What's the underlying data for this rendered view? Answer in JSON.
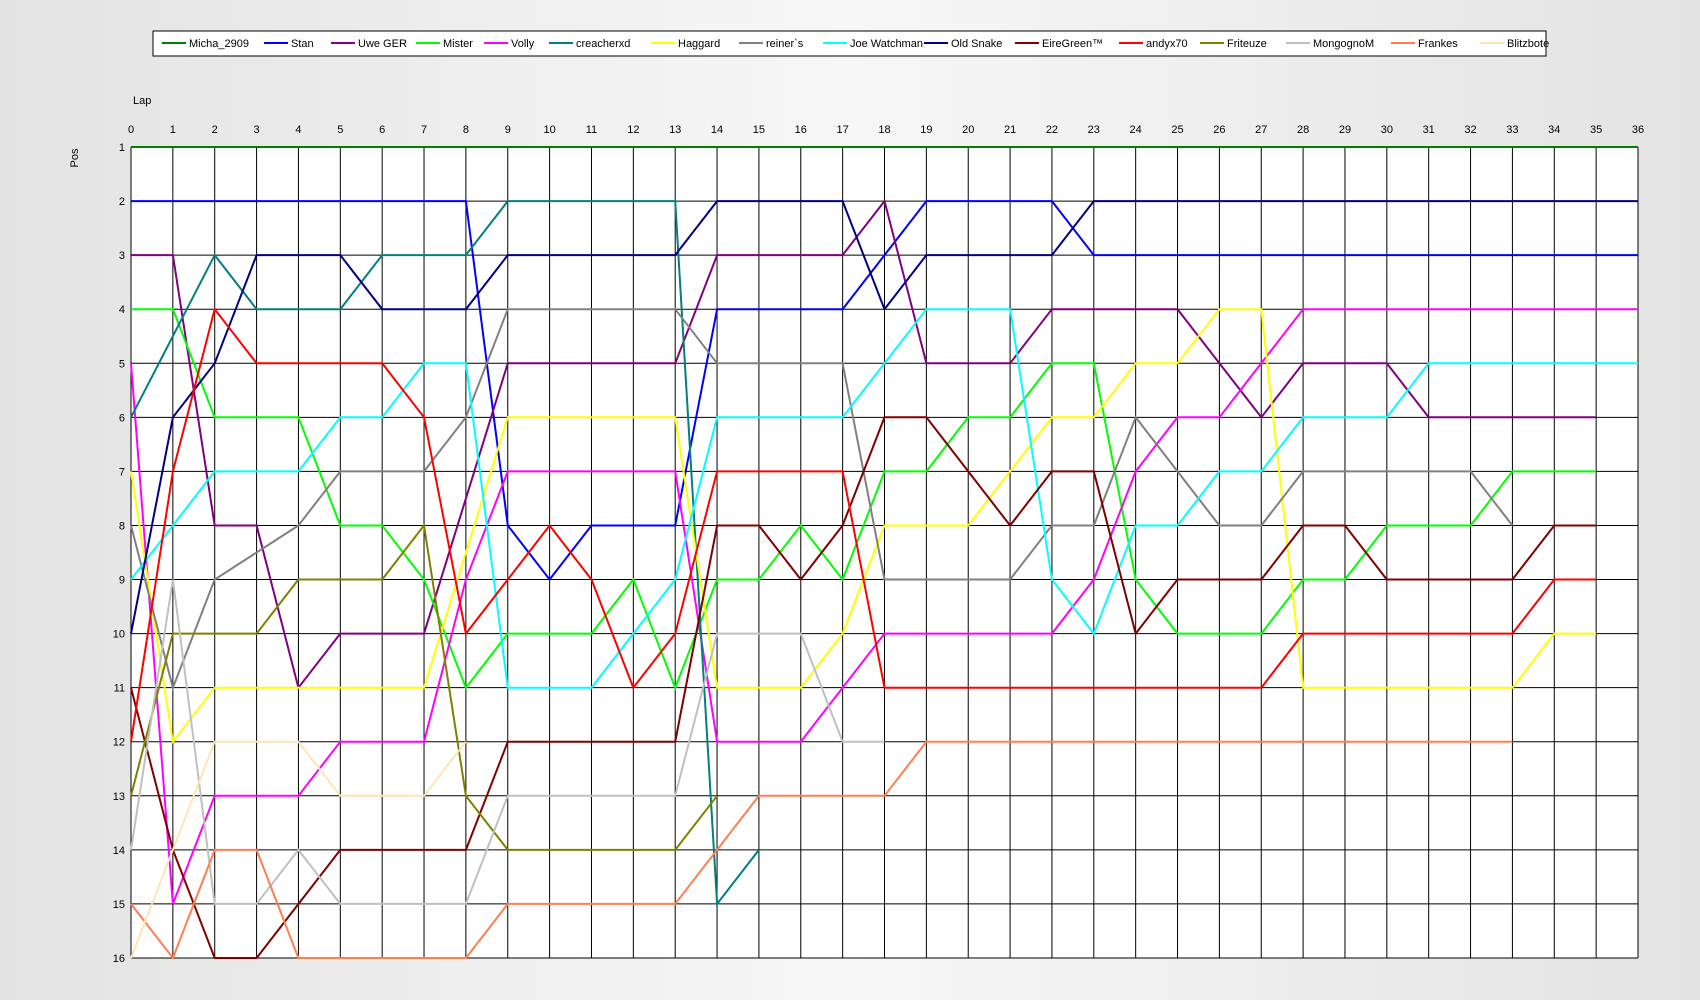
{
  "chart_data": {
    "type": "line",
    "xlabel": "Lap",
    "ylabel": "Pos",
    "xlim": [
      0,
      36
    ],
    "ylim": [
      1,
      16
    ],
    "y_inverted": true,
    "grid": true,
    "legend_position": "top",
    "x_ticks": [
      "0",
      "1",
      "2",
      "3",
      "4",
      "5",
      "6",
      "7",
      "8",
      "9",
      "10",
      "11",
      "12",
      "13",
      "14",
      "15",
      "16",
      "17",
      "18",
      "19",
      "20",
      "21",
      "22",
      "23",
      "24",
      "25",
      "26",
      "27",
      "28",
      "29",
      "30",
      "31",
      "32",
      "33",
      "34",
      "35",
      "36"
    ],
    "y_ticks": [
      "1",
      "2",
      "3",
      "4",
      "5",
      "6",
      "7",
      "8",
      "9",
      "10",
      "11",
      "12",
      "13",
      "14",
      "15",
      "16"
    ],
    "series": [
      {
        "name": "Micha_2909",
        "color": "#008000",
        "x": [
          0,
          36
        ],
        "y": [
          1,
          1
        ]
      },
      {
        "name": "Stan",
        "color": "#0000ff",
        "x": [
          0,
          8,
          9,
          10,
          11,
          13,
          14,
          17,
          19,
          22,
          23,
          36
        ],
        "y": [
          2,
          2,
          8,
          9,
          8,
          8,
          4,
          4,
          2,
          2,
          3,
          3
        ]
      },
      {
        "name": "Uwe GER",
        "color": "#800080",
        "x": [
          0,
          1,
          2,
          3,
          4,
          5,
          7,
          9,
          13,
          14,
          17,
          18,
          19,
          21,
          22,
          25,
          27,
          28,
          30,
          31,
          35
        ],
        "y": [
          3,
          3,
          8,
          8,
          11,
          10,
          10,
          5,
          5,
          3,
          3,
          2,
          5,
          5,
          4,
          4,
          6,
          5,
          5,
          6,
          6
        ]
      },
      {
        "name": "Mister",
        "color": "#00ff00",
        "x": [
          0,
          1,
          2,
          4,
          5,
          6,
          7,
          8,
          9,
          11,
          12,
          13,
          14,
          15,
          16,
          17,
          18,
          19,
          20,
          21,
          22,
          23,
          24,
          25,
          27,
          28,
          29,
          30,
          32,
          33,
          35
        ],
        "y": [
          4,
          4,
          6,
          6,
          8,
          8,
          9,
          11,
          10,
          10,
          9,
          11,
          9,
          9,
          8,
          9,
          7,
          7,
          6,
          6,
          5,
          5,
          9,
          10,
          10,
          9,
          9,
          8,
          8,
          7,
          7
        ]
      },
      {
        "name": "Volly",
        "color": "#ff00ff",
        "x": [
          0,
          1,
          2,
          4,
          5,
          7,
          8,
          9,
          13,
          14,
          16,
          18,
          22,
          23,
          24,
          25,
          26,
          28,
          36
        ],
        "y": [
          5,
          15,
          13,
          13,
          12,
          12,
          9,
          7,
          7,
          12,
          12,
          10,
          10,
          9,
          7,
          6,
          6,
          4,
          4
        ]
      },
      {
        "name": "creacherxd",
        "color": "#008080",
        "x": [
          0,
          2,
          3,
          5,
          6,
          8,
          9,
          13,
          14,
          15
        ],
        "y": [
          6,
          3,
          4,
          4,
          3,
          3,
          2,
          2,
          15,
          14
        ]
      },
      {
        "name": "Haggard",
        "color": "#ffff00",
        "x": [
          0,
          1,
          2,
          3,
          5,
          7,
          9,
          13,
          14,
          16,
          17,
          18,
          20,
          22,
          23,
          24,
          25,
          26,
          27,
          28,
          33,
          34,
          35
        ],
        "y": [
          7,
          12,
          11,
          11,
          11,
          11,
          6,
          6,
          11,
          11,
          10,
          8,
          8,
          6,
          6,
          5,
          5,
          4,
          4,
          11,
          11,
          10,
          10
        ]
      },
      {
        "name": "reiner`s",
        "color": "#808080",
        "x": [
          0,
          1,
          2,
          4,
          5,
          6,
          7,
          8,
          9,
          13,
          14,
          16,
          17,
          18,
          21,
          22,
          23,
          24,
          25,
          26,
          27,
          28,
          32,
          33
        ],
        "y": [
          8,
          11,
          9,
          8,
          7,
          7,
          7,
          6,
          4,
          4,
          5,
          5,
          5,
          9,
          9,
          8,
          8,
          6,
          7,
          8,
          8,
          7,
          7,
          8
        ]
      },
      {
        "name": "Joe Watchman",
        "color": "#00ffff",
        "x": [
          0,
          1,
          2,
          4,
          5,
          6,
          7,
          8,
          9,
          11,
          12,
          13,
          14,
          15,
          17,
          18,
          19,
          21,
          22,
          23,
          24,
          25,
          26,
          27,
          28,
          30,
          31,
          36
        ],
        "y": [
          9,
          8,
          7,
          7,
          6,
          6,
          5,
          5,
          11,
          11,
          10,
          9,
          6,
          6,
          6,
          5,
          4,
          4,
          9,
          10,
          8,
          8,
          7,
          7,
          6,
          6,
          5,
          5
        ]
      },
      {
        "name": "Old Snake",
        "color": "#000080",
        "x": [
          0,
          1,
          2,
          3,
          5,
          6,
          8,
          9,
          13,
          14,
          17,
          18,
          19,
          22,
          23,
          36
        ],
        "y": [
          10,
          6,
          5,
          3,
          3,
          4,
          4,
          3,
          3,
          2,
          2,
          4,
          3,
          3,
          2,
          2
        ]
      },
      {
        "name": "EireGreen™",
        "color": "#800000",
        "x": [
          0,
          1,
          2,
          3,
          5,
          8,
          9,
          13,
          14,
          15,
          16,
          17,
          18,
          19,
          21,
          22,
          23,
          24,
          25,
          27,
          28,
          29,
          30,
          33,
          34,
          35
        ],
        "y": [
          11,
          14,
          16,
          16,
          14,
          14,
          12,
          12,
          8,
          8,
          9,
          8,
          6,
          6,
          8,
          7,
          7,
          10,
          9,
          9,
          8,
          8,
          9,
          9,
          8,
          8
        ]
      },
      {
        "name": "andyx70",
        "color": "#ff0000",
        "x": [
          0,
          1,
          2,
          3,
          6,
          7,
          8,
          10,
          11,
          12,
          13,
          14,
          17,
          18,
          27,
          28,
          33,
          34,
          35
        ],
        "y": [
          12,
          7,
          4,
          5,
          5,
          6,
          10,
          8,
          9,
          11,
          10,
          7,
          7,
          11,
          11,
          10,
          10,
          9,
          9
        ]
      },
      {
        "name": "Friteuze",
        "color": "#808000",
        "x": [
          0,
          1,
          3,
          4,
          6,
          7,
          8,
          9,
          13,
          14
        ],
        "y": [
          13,
          10,
          10,
          9,
          9,
          8,
          13,
          14,
          14,
          13
        ]
      },
      {
        "name": "MongognoM",
        "color": "#c0c0c0",
        "x": [
          0,
          1,
          2,
          3,
          4,
          5,
          8,
          9,
          13,
          14,
          16,
          17,
          18
        ],
        "y": [
          14,
          9,
          15,
          15,
          14,
          15,
          15,
          13,
          13,
          10,
          10,
          12,
          12
        ]
      },
      {
        "name": "Frankes",
        "color": "#ff7f50",
        "x": [
          0,
          1,
          2,
          3,
          4,
          8,
          9,
          13,
          15,
          18,
          19,
          33
        ],
        "y": [
          15,
          16,
          14,
          14,
          16,
          16,
          15,
          15,
          13,
          13,
          12,
          12
        ]
      },
      {
        "name": "Blitzbote",
        "color": "#ffe4b5",
        "x": [
          0,
          2,
          4,
          5,
          7,
          8
        ],
        "y": [
          16,
          12,
          12,
          13,
          13,
          12
        ]
      }
    ]
  }
}
